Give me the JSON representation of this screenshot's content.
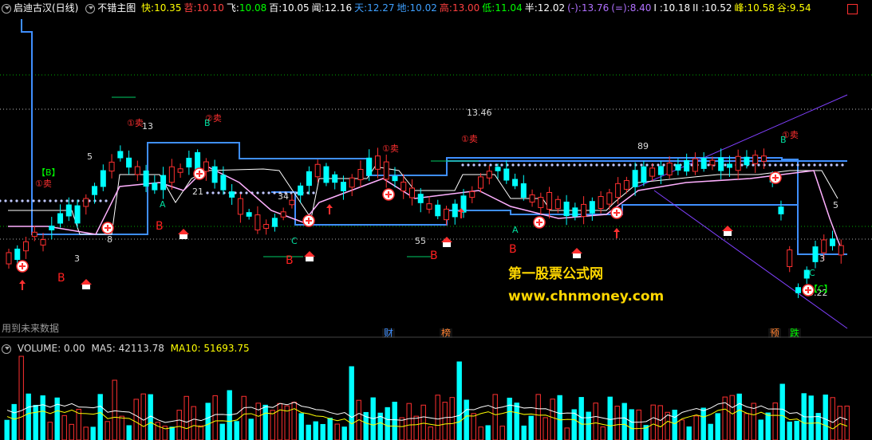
{
  "header": {
    "title": "启迪古汉(日线)",
    "indicator": "不错主图",
    "items": [
      {
        "label": "快:",
        "value": "10.35",
        "color": "#ffff00",
        "vcolor": "#ffff00"
      },
      {
        "label": "苕:",
        "value": "10.10",
        "color": "#ff4040",
        "vcolor": "#ff4040"
      },
      {
        "label": "飞:",
        "value": "10.08",
        "color": "#ffffff",
        "vcolor": "#00ff00"
      },
      {
        "label": "百:",
        "value": "10.05",
        "color": "#ffffff",
        "vcolor": "#ffffff"
      },
      {
        "label": "闻:",
        "value": "12.16",
        "color": "#ffffff",
        "vcolor": "#ffffff"
      },
      {
        "label": "天:",
        "value": "12.27",
        "color": "#3fa0ff",
        "vcolor": "#3fa0ff"
      },
      {
        "label": "地:",
        "value": "10.02",
        "color": "#3fa0ff",
        "vcolor": "#3fa0ff"
      },
      {
        "label": "高:",
        "value": "13.00",
        "color": "#ff4040",
        "vcolor": "#ff4040"
      },
      {
        "label": "低:",
        "value": "11.04",
        "color": "#00ff00",
        "vcolor": "#00ff00"
      },
      {
        "label": "半:",
        "value": "12.02",
        "color": "#ffffff",
        "vcolor": "#ffffff"
      },
      {
        "label": "(-):",
        "value": "13.76",
        "color": "#b070ff",
        "vcolor": "#b070ff"
      },
      {
        "label": "(=):",
        "value": "8.40",
        "color": "#b070ff",
        "vcolor": "#b070ff"
      },
      {
        "label": "I :",
        "value": "10.18",
        "color": "#ffffff",
        "vcolor": "#ffffff"
      },
      {
        "label": "II :",
        "value": "10.52",
        "color": "#ffffff",
        "vcolor": "#ffffff"
      },
      {
        "label": "峰:",
        "value": "10.58",
        "color": "#ffff00",
        "vcolor": "#ffff00"
      },
      {
        "label": "谷:",
        "value": "9.54",
        "color": "#ffff00",
        "vcolor": "#ffff00"
      }
    ]
  },
  "chart_labels": {
    "price_1346": "13.46",
    "price_522": "5.22",
    "n13": "13",
    "n5a": "5",
    "n5b": "5",
    "n89": "89",
    "n21": "21",
    "n34": "34",
    "n55": "55",
    "n8": "8",
    "n3a": "3",
    "n3b": "3",
    "sell": "①卖",
    "sell2": "②卖",
    "B": "B",
    "A": "A",
    "C": "C",
    "bracketB": "【B】",
    "bracketC": "【C】"
  },
  "markers": {
    "cai": "财",
    "bang": "榜",
    "yu": "预",
    "die": "跌"
  },
  "watermark": {
    "line1": "第一股票公式网",
    "line2": "www.chnmoney.com"
  },
  "note": "用到未来数据",
  "volume": {
    "label": "VOLUME:",
    "value": "0.00",
    "ma5_label": "MA5:",
    "ma5": "42113.78",
    "ma10_label": "MA10:",
    "ma10": "51693.75"
  },
  "colors": {
    "up": "#ff3030",
    "down": "#00ffff",
    "blue_line": "#3f8fff",
    "white_line": "#ffffff",
    "pink_line": "#ffb0ff",
    "purple_line": "#8040ff",
    "dots": "#c0c8ff"
  }
}
